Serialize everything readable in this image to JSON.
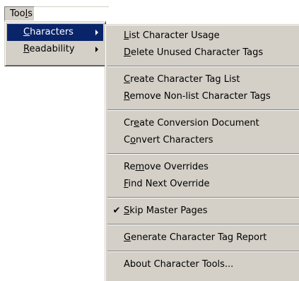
{
  "menubar": {
    "tools_label": "Tools",
    "tools_mnemonic_index": 3
  },
  "tools_menu": {
    "items": [
      {
        "label": "Characters",
        "mnemonic_index": 0,
        "has_submenu": true,
        "active": true
      },
      {
        "label": "Readability",
        "mnemonic_index": 0,
        "has_submenu": true,
        "active": false
      }
    ]
  },
  "characters_submenu": {
    "groups": [
      [
        {
          "label": "List Character Usage",
          "mnemonic_index": 0
        },
        {
          "label": "Delete Unused Character Tags",
          "mnemonic_index": 0
        }
      ],
      [
        {
          "label": "Create Character Tag List",
          "mnemonic_index": 0
        },
        {
          "label": "Remove Non-list Character Tags",
          "mnemonic_index": 0
        }
      ],
      [
        {
          "label": "Create Conversion Document",
          "mnemonic_index": 2
        },
        {
          "label": "Convert Characters",
          "mnemonic_index": 1
        }
      ],
      [
        {
          "label": "Remove Overrides",
          "mnemonic_index": 2
        },
        {
          "label": "Find Next Override",
          "mnemonic_index": 0
        }
      ],
      [
        {
          "label": "Skip Master Pages",
          "mnemonic_index": 0,
          "checked": true
        }
      ],
      [
        {
          "label": "Generate Character Tag Report",
          "mnemonic_index": 0
        }
      ],
      [
        {
          "label": "About Character Tools...",
          "mnemonic_index": -1
        }
      ]
    ],
    "check_glyph": "✔"
  },
  "colors": {
    "menu_face": "#d4d0c8",
    "highlight": "#0a246a",
    "highlight_text": "#ffffff"
  }
}
